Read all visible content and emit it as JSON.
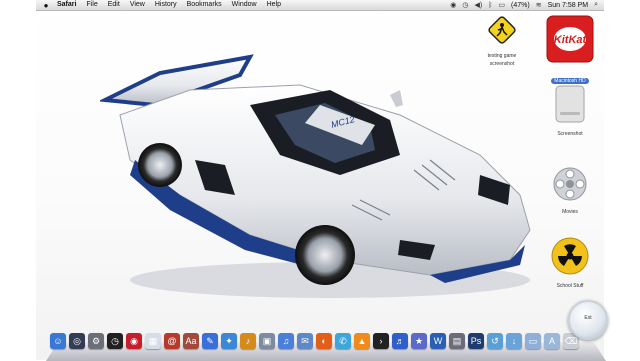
{
  "menubar": {
    "apple_icon": "apple-icon",
    "items": [
      "Safari",
      "File",
      "Edit",
      "View",
      "History",
      "Bookmarks",
      "Window",
      "Help"
    ],
    "battery": "(47%)",
    "clock": "Sun 7:58 PM"
  },
  "desktop_icons": [
    {
      "label": "testing game",
      "label2": "screenshot",
      "icon": "yield-sign-icon",
      "color": "#f4d21e"
    },
    {
      "label": "Macintosh HD",
      "icon": "kitkat-icon",
      "color": "#d81e1e",
      "selected": true
    },
    {
      "label": "Screenshot",
      "icon": "drive-icon",
      "color": "#d9d9d9"
    },
    {
      "label": "Movies",
      "icon": "film-reel-icon",
      "color": "#bfbfbf"
    },
    {
      "label": "School Stuff",
      "icon": "radiation-icon",
      "color": "#f3c11b"
    }
  ],
  "car": {
    "model_badge": "MC12",
    "body_color": "#eef0f3",
    "accent_color": "#1f3e8a"
  },
  "dock": {
    "magnifier_label": "Ext",
    "items": [
      {
        "icon": "finder-icon",
        "color": "#3a78d6"
      },
      {
        "icon": "dashboard-icon",
        "color": "#333b55"
      },
      {
        "icon": "system-prefs-icon",
        "color": "#6b6f78"
      },
      {
        "icon": "clock-icon",
        "color": "#202020"
      },
      {
        "icon": "photo-booth-icon",
        "color": "#c71e2c"
      },
      {
        "icon": "ical-icon",
        "color": "#d7dde8"
      },
      {
        "icon": "address-book-icon",
        "color": "#b73b2d"
      },
      {
        "icon": "dictionary-icon",
        "color": "#a14a3b"
      },
      {
        "icon": "pages-icon",
        "color": "#3a6fd9"
      },
      {
        "icon": "safari-icon",
        "color": "#3a88d6"
      },
      {
        "icon": "garageband-icon",
        "color": "#d58a1c"
      },
      {
        "icon": "preview-icon",
        "color": "#7d8ba0"
      },
      {
        "icon": "itunes-icon",
        "color": "#4c7fd8"
      },
      {
        "icon": "mail-icon",
        "color": "#5e88c7"
      },
      {
        "icon": "firefox-icon",
        "color": "#e35f19"
      },
      {
        "icon": "ichat-icon",
        "color": "#3fa6d9"
      },
      {
        "icon": "vlc-icon",
        "color": "#f08a1a"
      },
      {
        "icon": "terminal-icon",
        "color": "#222222"
      },
      {
        "icon": "itunes-blue-icon",
        "color": "#2f5fc9"
      },
      {
        "icon": "imovie-icon",
        "color": "#5b6bc6"
      },
      {
        "icon": "word-icon",
        "color": "#2b5fb5"
      },
      {
        "icon": "spaces-icon",
        "color": "#6b6b7a"
      },
      {
        "icon": "photoshop-icon",
        "color": "#1e3d6e"
      },
      {
        "icon": "timemachine-icon",
        "color": "#5aa0d8"
      },
      {
        "icon": "downloads-icon",
        "color": "#6aa3d9"
      },
      {
        "icon": "documents-icon",
        "color": "#8fb0d6"
      },
      {
        "icon": "applications-icon",
        "color": "#9bb7d8"
      },
      {
        "icon": "trash-icon",
        "color": "#c9ced6"
      }
    ]
  }
}
